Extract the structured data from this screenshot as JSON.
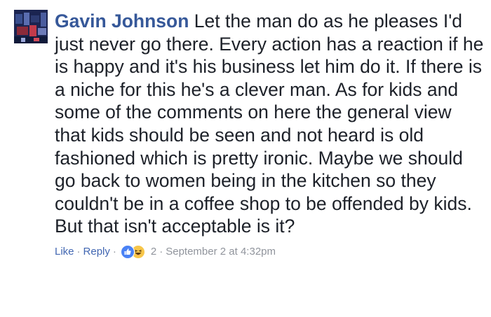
{
  "comment": {
    "author": "Gavin Johnson",
    "text": "Let the man do as he pleases I'd just never go there. Every action has a reaction if he is happy and it's his business let him do it. If there is a niche for this he's a clever man. As for kids and some of the comments on here the general view that kids should be seen and not heard is old fashioned which is pretty ironic. Maybe we should go back to women being in the kitchen so they couldn't be in a coffee shop to be offended by kids. But that isn't acceptable is it?",
    "actions": {
      "like_label": "Like",
      "reply_label": "Reply",
      "separator": "·",
      "reaction_count": "2",
      "timestamp": "September 2 at 4:32pm"
    },
    "reactions": [
      "like-icon",
      "haha-icon"
    ]
  },
  "colors": {
    "author": "#365899",
    "text": "#1d2129",
    "link": "#4267b2",
    "meta": "#90949c",
    "like": "#4a82f5",
    "haha": "#f7c64a"
  }
}
